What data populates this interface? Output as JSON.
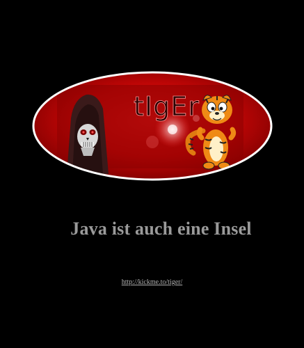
{
  "logo": {
    "text": "tIgEr"
  },
  "headline": "Java ist auch eine Insel",
  "link": "http://kickme.to/tiger/"
}
